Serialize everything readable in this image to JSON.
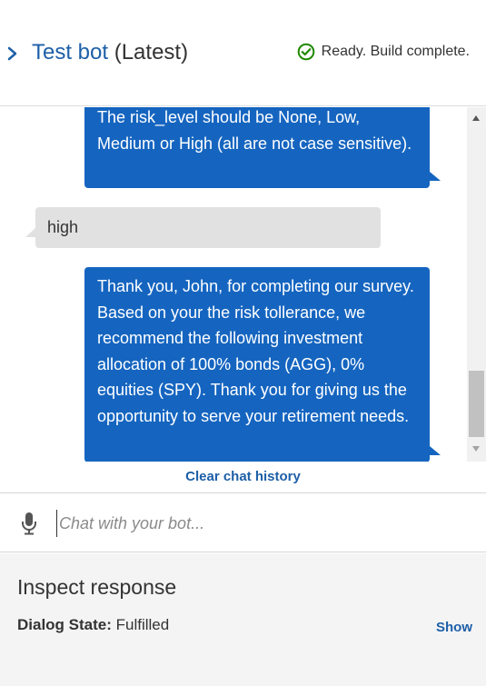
{
  "header": {
    "title_name": "Test bot",
    "title_version": "(Latest)",
    "status_text": "Ready. Build complete.",
    "status_icon": "check-circle-icon",
    "accent_color": "#1d5fa8",
    "status_color": "#1e8900"
  },
  "chat": {
    "messages": [
      {
        "from": "bot",
        "text": "The risk_level should be None, Low, Medium or High (all are not case sensitive)."
      },
      {
        "from": "user",
        "text": "high"
      },
      {
        "from": "bot",
        "text": "Thank you, John, for completing our survey. Based on your the risk tollerance, we recommend the following investment allocation of 100% bonds (AGG), 0% equities (SPY). Thank you for giving us the opportunity to serve your retirement needs."
      }
    ],
    "bot_bubble_color": "#1565c0",
    "user_bubble_color": "#e1e1e1",
    "clear_label": "Clear chat history"
  },
  "input": {
    "placeholder": "Chat with your bot...",
    "value": "",
    "mic_icon": "microphone-icon"
  },
  "inspect": {
    "title": "Inspect response",
    "dialog_state_label": "Dialog State:",
    "dialog_state_value": "Fulfilled",
    "show_label": "Show"
  }
}
